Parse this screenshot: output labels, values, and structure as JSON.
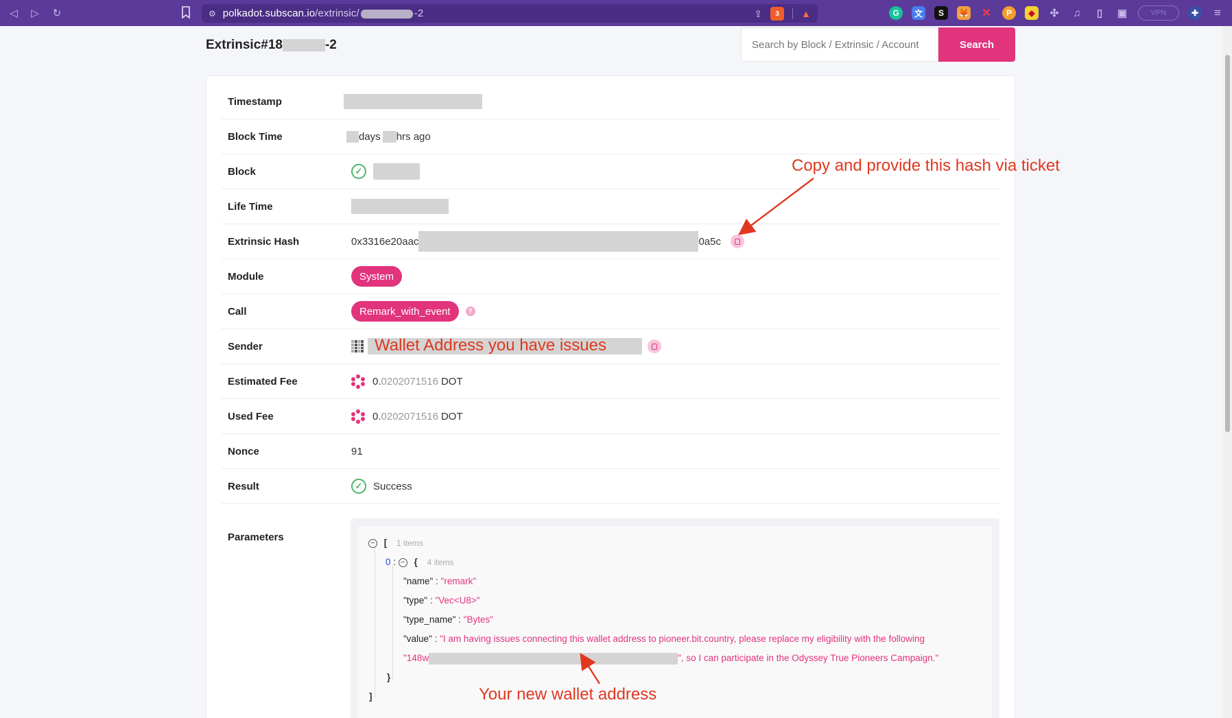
{
  "browser": {
    "url_host": "polkadot.subscan.io",
    "url_path_prefix": "/extrinsic/",
    "url_path_suffix": "-2",
    "brave_badge": "3",
    "vpn_label": "VPN"
  },
  "page": {
    "title_prefix": "Extrinsic#18",
    "title_suffix": "-2",
    "search": {
      "placeholder": "Search by Block / Extrinsic / Account",
      "button_label": "Search"
    }
  },
  "details": {
    "timestamp_label": "Timestamp",
    "block_time_label": "Block Time",
    "block_time_days": "days",
    "block_time_hrs": "hrs ago",
    "block_label": "Block",
    "life_time_label": "Life Time",
    "hash_label": "Extrinsic Hash",
    "hash_prefix": "0x3316e20aac",
    "hash_suffix": "0a5c",
    "module_label": "Module",
    "module_value": "System",
    "call_label": "Call",
    "call_value": "Remark_with_event",
    "sender_label": "Sender",
    "est_fee_label": "Estimated Fee",
    "est_fee_int": "0.",
    "est_fee_dec": "0202071516",
    "est_fee_unit": "DOT",
    "used_fee_label": "Used Fee",
    "used_fee_int": "0.",
    "used_fee_dec": "0202071516",
    "used_fee_unit": "DOT",
    "nonce_label": "Nonce",
    "nonce_value": "91",
    "result_label": "Result",
    "result_value": "Success",
    "params_label": "Parameters"
  },
  "params": {
    "open_bracket": "[",
    "outer_count": "1 items",
    "index": "0",
    "open_brace": "{",
    "inner_count": "4 items",
    "name_key": "\"name\"",
    "name_val": "\"remark\"",
    "type_key": "\"type\"",
    "type_val": "\"Vec<U8>\"",
    "type_name_key": "\"type_name\"",
    "type_name_val": "\"Bytes\"",
    "value_key": "\"value\"",
    "value_line1": "\"I am having issues connecting this wallet address to pioneer.bit.country, please replace my eligibility with the following",
    "value_line2_prefix": "\"148w",
    "value_line2_suffix": "\", so I can participate in the Odyssey True Pioneers Campaign.\"",
    "close_brace": "}",
    "close_bracket": "]"
  },
  "annotations": {
    "hash_note": "Copy and provide this hash via ticket",
    "sender_note": "Wallet Address you have issues",
    "new_wallet_note": "Your new wallet address"
  },
  "colors": {
    "accent": "#e2337d",
    "annotation": "#e0381f",
    "success": "#4fb56d",
    "browser_bar": "#5b3a99"
  }
}
